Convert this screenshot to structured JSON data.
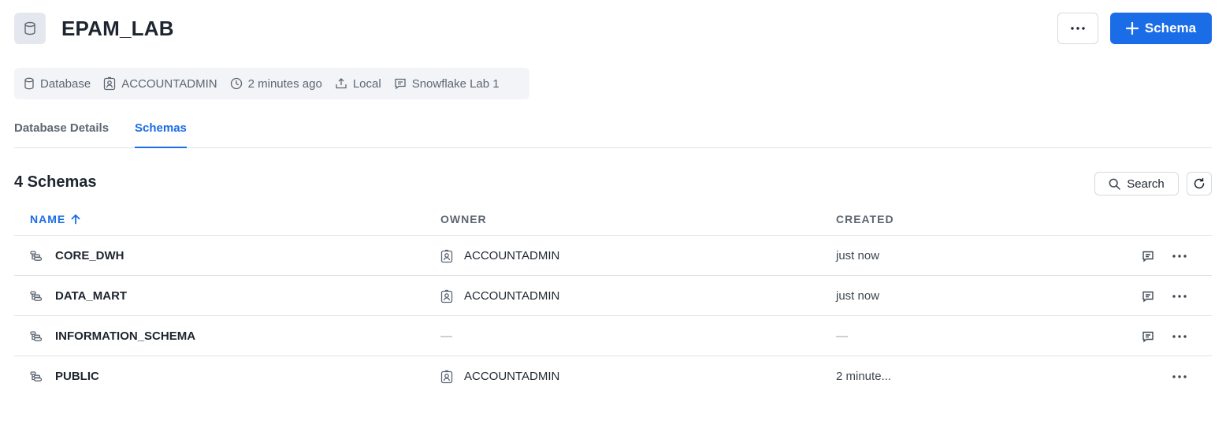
{
  "header": {
    "title": "EPAM_LAB",
    "more_label": "···",
    "add_schema_label": "Schema",
    "add_schema_icon": "plus-icon"
  },
  "meta": {
    "type": "Database",
    "owner": "ACCOUNTADMIN",
    "created": "2 minutes ago",
    "origin": "Local",
    "comment": "Snowflake Lab 1"
  },
  "tabs": [
    {
      "label": "Database Details",
      "active": false
    },
    {
      "label": "Schemas",
      "active": true
    }
  ],
  "section": {
    "title": "4 Schemas",
    "search_label": "Search"
  },
  "table": {
    "columns": [
      "NAME",
      "OWNER",
      "CREATED"
    ],
    "sort": {
      "column": "NAME",
      "direction": "ascending"
    },
    "rows": [
      {
        "name": "CORE_DWH",
        "owner": "ACCOUNTADMIN",
        "created": "just now",
        "has_comment": true
      },
      {
        "name": "DATA_MART",
        "owner": "ACCOUNTADMIN",
        "created": "just now",
        "has_comment": true
      },
      {
        "name": "INFORMATION_SCHEMA",
        "owner": "—",
        "created": "—",
        "has_comment": true
      },
      {
        "name": "PUBLIC",
        "owner": "ACCOUNTADMIN",
        "created": "2 minute...",
        "has_comment": false
      }
    ]
  },
  "colors": {
    "accent": "#1a6ce7",
    "text": "#1e252f",
    "muted": "#5d6672",
    "border": "#dfe3e8"
  }
}
